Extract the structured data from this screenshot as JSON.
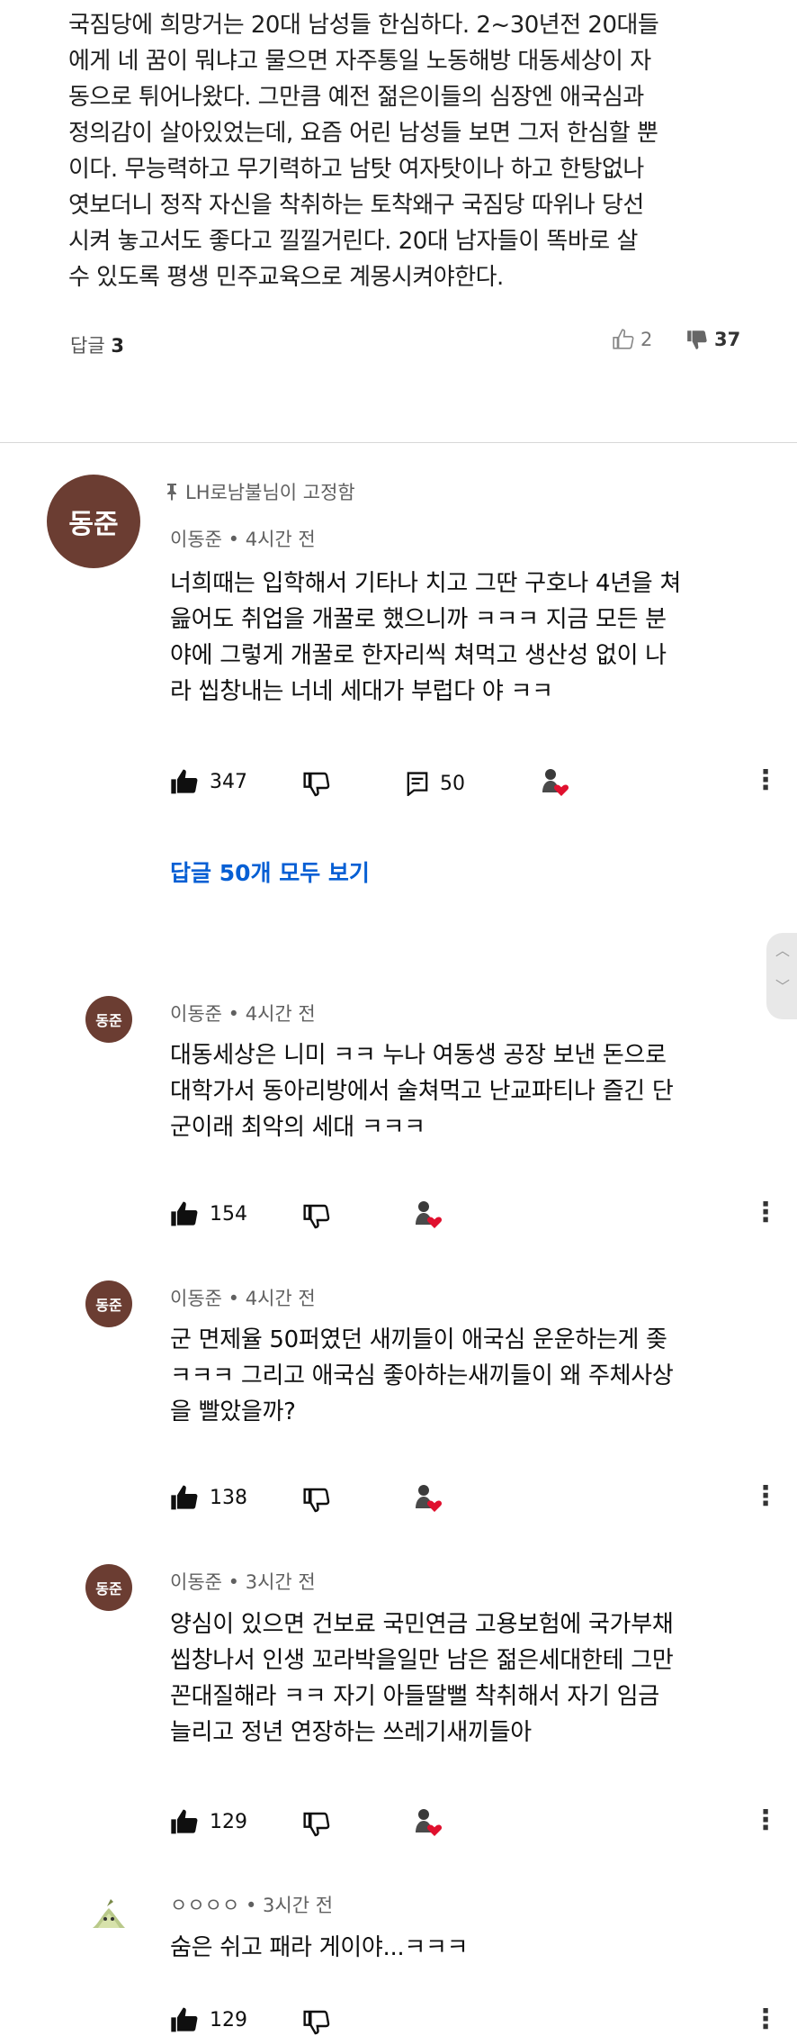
{
  "top_comment": {
    "lines": [
      "국짐당에 희망거는 20대 남성들 한심하다. 2~30년전 20대들",
      "에게 네 꿈이 뭐냐고 물으면 자주통일 노동해방 대동세상이 자",
      "동으로 튀어나왔다. 그만큼 예전 젊은이들의 심장엔 애국심과",
      "정의감이 살아있었는데, 요즘 어린 남성들 보면 그저 한심할 뿐",
      "이다. 무능력하고 무기력하고 남탓 여자탓이나 하고 한탕없나",
      "엿보더니 정작 자신을 착취하는 토착왜구 국짐당 따위나 당선",
      "시켜 놓고서도 좋다고 낄낄거린다. 20대 남자들이 똑바로 살",
      "수 있도록 평생 민주교육으로 계몽시켜야한다."
    ],
    "replies_label": "답글",
    "replies_count": "3",
    "likes": "2",
    "dislikes": "37"
  },
  "pinned": {
    "avatar_text": "동준",
    "pin_label": "LH로남불님이 고정함",
    "author": "이동준",
    "time": "4시간 전",
    "lines": [
      "너희때는 입학해서 기타나 치고 그딴 구호나 4년을 쳐",
      "읊어도 취업을 개꿀로 했으니까 ㅋㅋㅋ 지금 모든 분",
      "야에 그렇게 개꿀로 한자리씩 쳐먹고 생산성 없이 나",
      "라 씹창내는 너네 세대가 부럽다 야 ㅋㅋ"
    ],
    "likes": "347",
    "reply_count": "50",
    "view_replies": "답글 50개 모두 보기"
  },
  "replies": [
    {
      "avatar_text": "동준",
      "author": "이동준",
      "time": "4시간 전",
      "lines": [
        "대동세상은 니미 ㅋㅋ 누나 여동생 공장 보낸 돈으로",
        "대학가서 동아리방에서 술쳐먹고 난교파티나 즐긴 단",
        "군이래 최악의 세대 ㅋㅋㅋ"
      ],
      "likes": "154"
    },
    {
      "avatar_text": "동준",
      "author": "이동준",
      "time": "4시간 전",
      "lines": [
        "군 면제율 50퍼였던 새끼들이 애국심 운운하는게 좆",
        "ㅋㅋㅋ 그리고 애국심 좋아하는새끼들이 왜 주체사상",
        "을 빨았을까?"
      ],
      "likes": "138"
    },
    {
      "avatar_text": "동준",
      "author": "이동준",
      "time": "3시간 전",
      "lines": [
        "양심이 있으면 건보료 국민연금 고용보험에 국가부채",
        "씹창나서 인생 꼬라박을일만 남은 젊은세대한테 그만",
        "꼰대질해라 ㅋㅋ 자기 아들딸뻘 착취해서 자기 임금",
        "늘리고 정년 연장하는 쓰레기새끼들아"
      ],
      "likes": "129"
    },
    {
      "avatar_text": "",
      "author": "ㅇㅇㅇㅇ",
      "time": "3시간 전",
      "lines": [
        "숨은 쉬고 패라 게이야...ㅋㅋㅋ"
      ],
      "likes": "129"
    }
  ],
  "meta_separator": "•",
  "colors": {
    "link_blue": "#065fd4",
    "avatar_brown": "#6b3d32",
    "heart_red": "#e0102e",
    "text_dark": "#0f0f0f",
    "text_gray": "#606060"
  },
  "icons": {
    "like": "thumbs-up-filled-icon",
    "dislike": "thumbs-down-outline-icon",
    "reply": "reply-comment-icon",
    "heart": "creator-heart-icon",
    "more": "more-vertical-icon",
    "pin": "pin-icon"
  }
}
